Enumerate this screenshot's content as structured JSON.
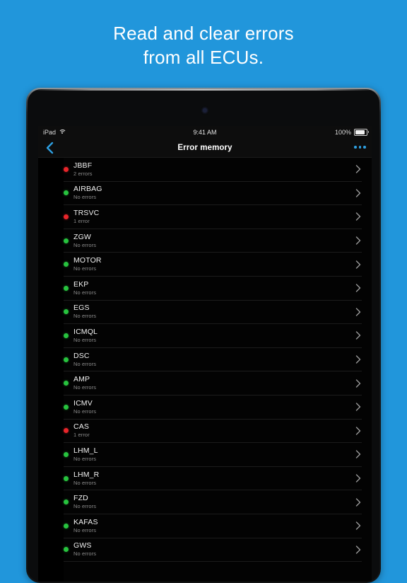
{
  "marketing": {
    "line1": "Read and clear errors",
    "line2": "from all ECUs.",
    "background_color": "#2196DB",
    "text_color": "#FFFFFF"
  },
  "device": {
    "type": "tablet",
    "frame_color": "#17191b",
    "camera_icon": "camera-dot"
  },
  "status_bar": {
    "carrier_label": "iPad",
    "wifi_icon": "wifi-icon",
    "time": "9:41 AM",
    "battery_percent": "100%",
    "battery_icon": "battery-full-icon"
  },
  "nav_bar": {
    "back_icon": "chevron-left-icon",
    "title": "Error memory",
    "more_icon": "more-horizontal-icon",
    "accent_color": "#2E9FE0"
  },
  "status_colors": {
    "error": "#E8252A",
    "ok": "#27C33E"
  },
  "list": {
    "chevron_icon": "chevron-right-icon",
    "rows": [
      {
        "name": "JBBF",
        "status_text": "2 errors",
        "status": "error"
      },
      {
        "name": "AIRBAG",
        "status_text": "No errors",
        "status": "ok"
      },
      {
        "name": "TRSVC",
        "status_text": "1 error",
        "status": "error"
      },
      {
        "name": "ZGW",
        "status_text": "No errors",
        "status": "ok"
      },
      {
        "name": "MOTOR",
        "status_text": "No errors",
        "status": "ok"
      },
      {
        "name": "EKP",
        "status_text": "No errors",
        "status": "ok"
      },
      {
        "name": "EGS",
        "status_text": "No errors",
        "status": "ok"
      },
      {
        "name": "ICMQL",
        "status_text": "No errors",
        "status": "ok"
      },
      {
        "name": "DSC",
        "status_text": "No errors",
        "status": "ok"
      },
      {
        "name": "AMP",
        "status_text": "No errors",
        "status": "ok"
      },
      {
        "name": "ICMV",
        "status_text": "No errors",
        "status": "ok"
      },
      {
        "name": "CAS",
        "status_text": "1 error",
        "status": "error"
      },
      {
        "name": "LHM_L",
        "status_text": "No errors",
        "status": "ok"
      },
      {
        "name": "LHM_R",
        "status_text": "No errors",
        "status": "ok"
      },
      {
        "name": "FZD",
        "status_text": "No errors",
        "status": "ok"
      },
      {
        "name": "KAFAS",
        "status_text": "No errors",
        "status": "ok"
      },
      {
        "name": "GWS",
        "status_text": "No errors",
        "status": "ok"
      }
    ]
  }
}
